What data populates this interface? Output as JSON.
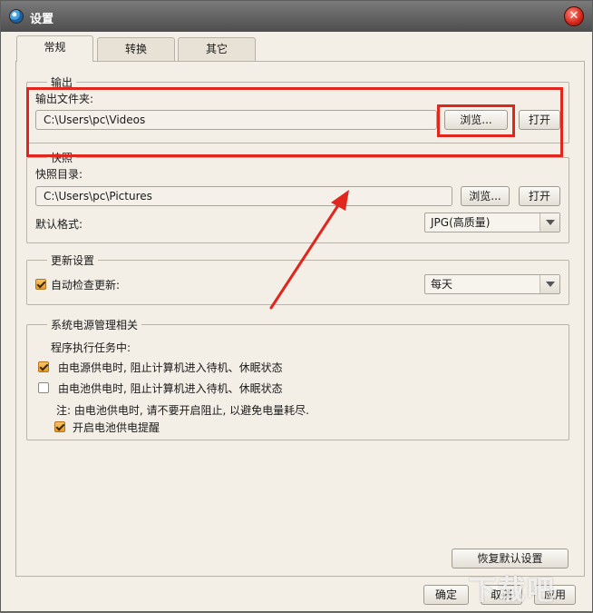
{
  "window": {
    "title": "设置"
  },
  "tabs": [
    {
      "label": "常规",
      "active": true
    },
    {
      "label": "转换",
      "active": false
    },
    {
      "label": "其它",
      "active": false
    }
  ],
  "output": {
    "group_title": "输出",
    "folder_label": "输出文件夹:",
    "folder_path": "C:\\Users\\pc\\Videos",
    "browse_label": "浏览...",
    "open_label": "打开"
  },
  "snapshot": {
    "group_title": "快照",
    "dir_label": "快照目录:",
    "dir_path": "C:\\Users\\pc\\Pictures",
    "browse_label": "浏览...",
    "open_label": "打开",
    "format_label": "默认格式:",
    "format_value": "JPG(高质量)"
  },
  "update": {
    "group_title": "更新设置",
    "auto_check_label": "自动检查更新:",
    "auto_check_checked": true,
    "frequency_value": "每天"
  },
  "power": {
    "group_title": "系统电源管理相关",
    "subtitle": "程序执行任务中:",
    "ac_label": "由电源供电时, 阻止计算机进入待机、休眠状态",
    "ac_checked": true,
    "battery_label": "由电池供电时, 阻止计算机进入待机、休眠状态",
    "battery_checked": false,
    "note": "注: 由电池供电时, 请不要开启阻止, 以避免电量耗尽.",
    "battery_reminder_label": "开启电池供电提醒",
    "battery_reminder_checked": true
  },
  "buttons": {
    "restore_defaults": "恢复默认设置",
    "ok": "确定",
    "cancel": "取消",
    "apply": "应用"
  },
  "colors": {
    "annotation": "#e0261d",
    "checkbox_checked": "#e89a2b"
  }
}
